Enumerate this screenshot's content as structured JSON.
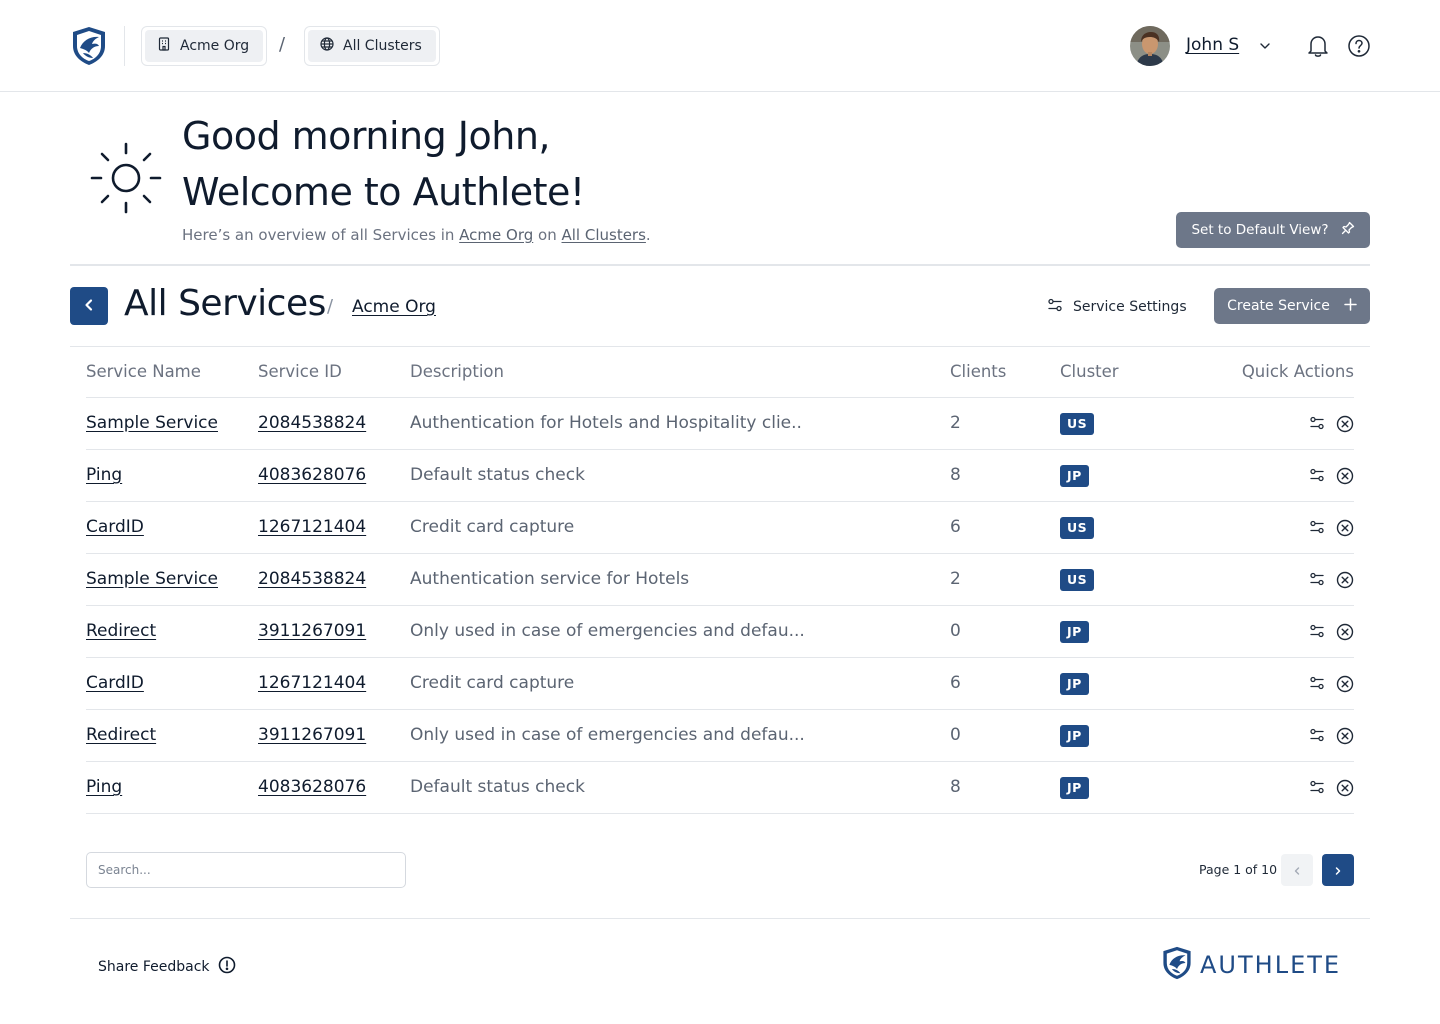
{
  "header": {
    "org": "Acme Org",
    "breadcrumb_sep": "/",
    "cluster": "All Clusters",
    "user_name": "John S"
  },
  "greeting": {
    "line1": "Good morning John,",
    "line2": "Welcome to Authlete!",
    "overview_prefix": "Here’s an overview of all Services in",
    "overview_org": "Acme Org",
    "overview_mid": "on",
    "overview_cluster": "All Clusters",
    "overview_suffix": ".",
    "default_view_button": "Set to Default View?"
  },
  "section": {
    "title": "All Services",
    "sep": "/",
    "org": "Acme Org",
    "settings_label": "Service Settings",
    "create_label": "Create Service"
  },
  "table": {
    "headers": {
      "name": "Service Name",
      "id": "Service ID",
      "description": "Description",
      "clients": "Clients",
      "cluster": "Cluster",
      "actions": "Quick Actions"
    },
    "rows": [
      {
        "name": "Sample Service",
        "id": "2084538824",
        "description": "Authentication for Hotels and Hospitality clie..",
        "clients": "2",
        "cluster": "US"
      },
      {
        "name": "Ping",
        "id": "4083628076",
        "description": "Default status check",
        "clients": "8",
        "cluster": "JP"
      },
      {
        "name": "CardID",
        "id": "1267121404",
        "description": "Credit card capture",
        "clients": "6",
        "cluster": "US"
      },
      {
        "name": "Sample Service",
        "id": "2084538824",
        "description": "Authentication service for Hotels",
        "clients": "2",
        "cluster": "US"
      },
      {
        "name": "Redirect",
        "id": "3911267091",
        "description": "Only used in case of emergencies and defau...",
        "clients": "0",
        "cluster": "JP"
      },
      {
        "name": "CardID",
        "id": "1267121404",
        "description": "Credit card capture",
        "clients": "6",
        "cluster": "JP"
      },
      {
        "name": "Redirect",
        "id": "3911267091",
        "description": "Only used in case of emergencies and defau...",
        "clients": "0",
        "cluster": "JP"
      },
      {
        "name": "Ping",
        "id": "4083628076",
        "description": "Default status check",
        "clients": "8",
        "cluster": "JP"
      }
    ]
  },
  "search": {
    "placeholder": "Search..."
  },
  "pagination": {
    "label": "Page 1 of 10"
  },
  "footer": {
    "feedback": "Share Feedback",
    "brand": "AUTHLETE"
  },
  "colors": {
    "primary": "#1f4b86",
    "muted_button": "#6d7789",
    "text": "#0f1b2d",
    "secondary_text": "#6b7280",
    "border": "#e3e6ea"
  },
  "icons": {
    "logo": "shield-eagle-icon",
    "org": "building-icon",
    "cluster": "globe-icon",
    "user_menu": "chevron-down-icon",
    "notifications": "bell-icon",
    "help": "question-circle-icon",
    "greeting": "sun-icon",
    "default_view": "pin-icon",
    "back": "chevron-left-icon",
    "settings": "sliders-icon",
    "create": "plus-icon",
    "delete": "x-circle-icon",
    "feedback": "exclamation-circle-icon"
  }
}
